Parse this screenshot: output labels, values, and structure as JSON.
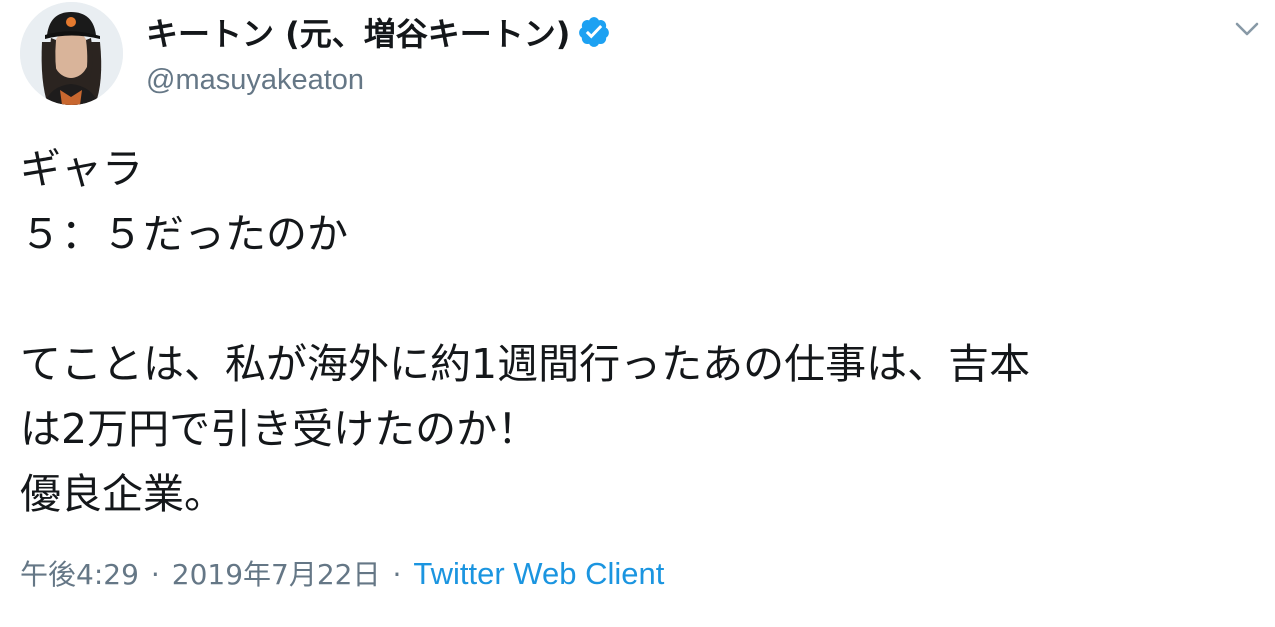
{
  "user": {
    "display_name": "キートン (元、増谷キートン)",
    "screen_name": "@masuyakeaton",
    "verified": true
  },
  "tweet": {
    "lines": [
      "ギャラ",
      "５：５だったのか",
      "",
      "てことは、私が海外に約1週間行ったあの仕事は、吉本",
      "は2万円で引き受けたのか！",
      "優良企業。"
    ]
  },
  "meta": {
    "time": "午後4:29",
    "separator": "·",
    "date": "2019年7月22日",
    "source": "Twitter Web Client"
  },
  "colors": {
    "text": "#14171a",
    "secondary": "#657786",
    "link": "#1b95e0",
    "verified": "#1da1f2"
  },
  "icons": {
    "avatar": "avatar-photo",
    "verified": "verified-badge-icon",
    "caret": "chevron-down-icon"
  }
}
